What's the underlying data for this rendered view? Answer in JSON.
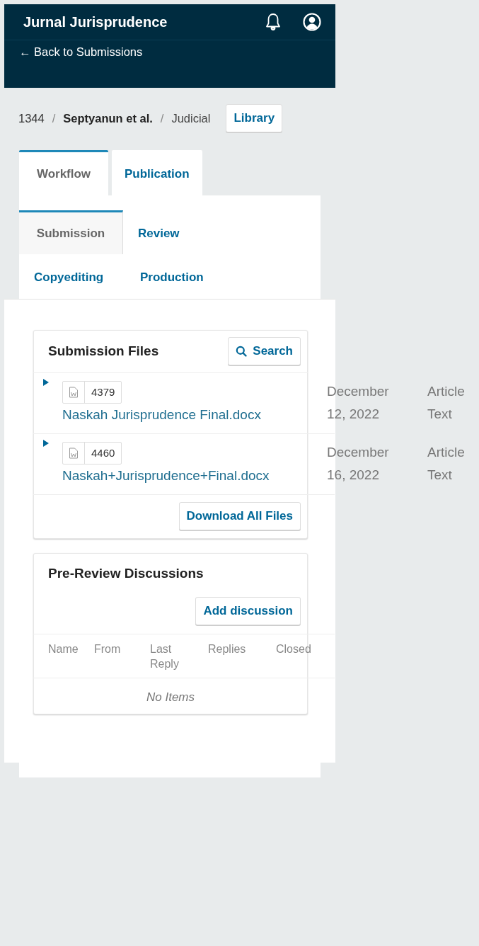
{
  "header": {
    "title": "Jurnal Jurisprudence",
    "back_link": "← Back to Submissions"
  },
  "breadcrumb": {
    "id": "1344",
    "separator": "/",
    "authors": "Septyanun et al.",
    "title": "Judicial",
    "button": "Library"
  },
  "tabs": [
    {
      "label": "Workflow",
      "selected": true
    },
    {
      "label": "Publication",
      "selected": false
    }
  ],
  "stage_tabs": [
    {
      "label": "Submission",
      "selected": true
    },
    {
      "label": "Review",
      "selected": false
    },
    {
      "label": "Copyediting",
      "selected": false
    },
    {
      "label": "Production",
      "selected": false
    }
  ],
  "files_panel": {
    "title": "Submission Files",
    "search_button": "Search",
    "files": [
      {
        "id": "4379",
        "name": "Naskah Jurisprudence Final.docx",
        "date": "December 12, 2022",
        "type": "Article Text"
      },
      {
        "id": "4460",
        "name": "Naskah+Jurisprudence+Final.docx",
        "date": "December 16, 2022",
        "type": "Article Text"
      }
    ],
    "download_button": "Download All Files"
  },
  "discussions": {
    "title": "Pre-Review Discussions",
    "add_button": "Add discussion",
    "columns": [
      "Name",
      "From",
      "Last Reply",
      "Replies",
      "Closed"
    ],
    "empty": "No Items"
  }
}
